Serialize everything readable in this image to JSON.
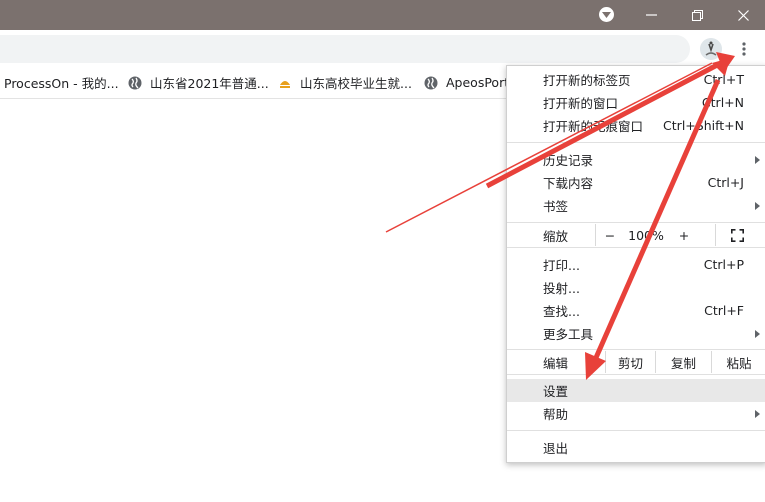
{
  "window": {
    "controls": {
      "minimize": "—",
      "maximize": "❐",
      "close": "✕"
    }
  },
  "bookmarks": [
    {
      "label": "ProcessOn - 我的...",
      "icon": "none"
    },
    {
      "label": "山东省2021年普通...",
      "icon": "globe-icon"
    },
    {
      "label": "山东高校毕业生就...",
      "icon": "school-logo-icon"
    },
    {
      "label": "ApeosPort",
      "icon": "globe-icon"
    }
  ],
  "menu": {
    "new_tab": {
      "label": "打开新的标签页",
      "shortcut": "Ctrl+T"
    },
    "new_window": {
      "label": "打开新的窗口",
      "shortcut": "Ctrl+N"
    },
    "new_incognito": {
      "label": "打开新的无痕窗口",
      "shortcut": "Ctrl+Shift+N"
    },
    "history": {
      "label": "历史记录"
    },
    "downloads": {
      "label": "下载内容",
      "shortcut": "Ctrl+J"
    },
    "bookmarks": {
      "label": "书签"
    },
    "zoom": {
      "label": "缩放",
      "minus": "−",
      "value": "100%",
      "plus": "+"
    },
    "print": {
      "label": "打印...",
      "shortcut": "Ctrl+P"
    },
    "cast": {
      "label": "投射..."
    },
    "find": {
      "label": "查找...",
      "shortcut": "Ctrl+F"
    },
    "more_tools": {
      "label": "更多工具"
    },
    "edit": {
      "label": "编辑",
      "cut": "剪切",
      "copy": "复制",
      "paste": "粘贴"
    },
    "settings": {
      "label": "设置"
    },
    "help": {
      "label": "帮助"
    },
    "exit": {
      "label": "退出"
    }
  },
  "colors": {
    "titlebar": "#7b716e",
    "annotation_arrow": "#e8413a",
    "highlight": "#e8e8e8"
  }
}
